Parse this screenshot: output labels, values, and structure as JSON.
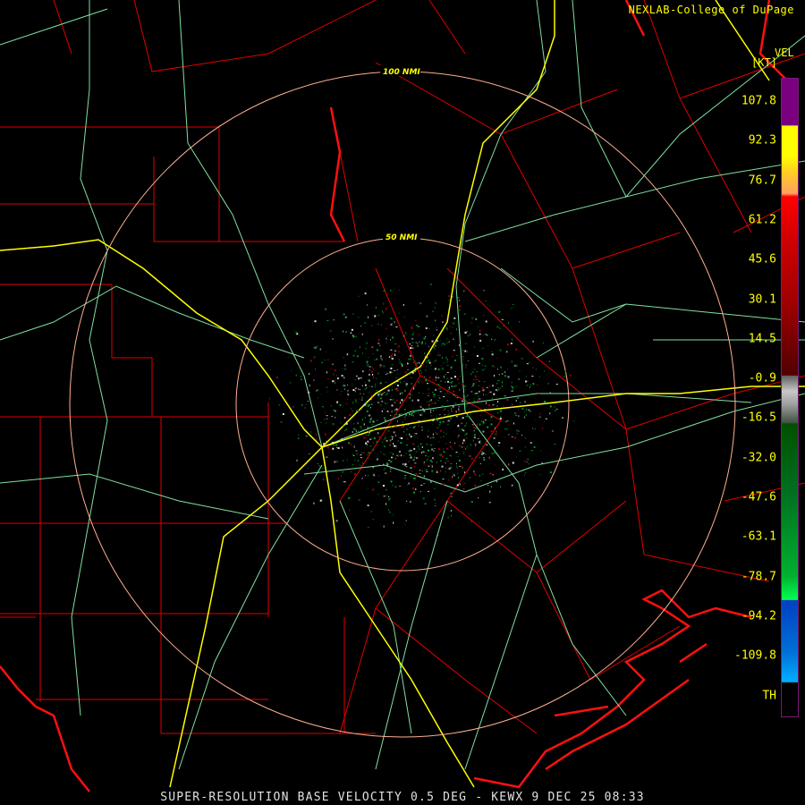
{
  "credit": "NEXLAB-College of DuPage",
  "credit_logo": "NEXLAB-College of DuPage logo mark",
  "legend": {
    "product": "VEL",
    "unit": "[KT]",
    "labels": [
      "107.8",
      "92.3",
      "76.7",
      "61.2",
      "45.6",
      "30.1",
      "14.5",
      "-0.9",
      "-16.5",
      "-32.0",
      "-47.6",
      "-63.1",
      "-78.7",
      "-94.2",
      "-109.8",
      "TH"
    ]
  },
  "rings": [
    {
      "label": "100 NMI"
    },
    {
      "label": "50 NMI"
    }
  ],
  "caption": "SUPER-RESOLUTION BASE VELOCITY 0.5 DEG - KEWX 9 DEC 25 08:33",
  "colors": {
    "county": "#ff0000",
    "highway": "#ffff00",
    "road": "#80e0a0",
    "ring": "#ffb090",
    "text": "#ffff00"
  }
}
